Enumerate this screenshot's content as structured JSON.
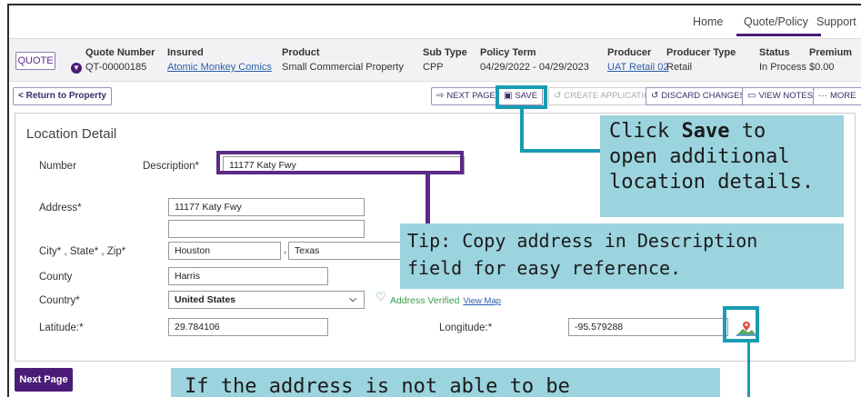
{
  "topnav": {
    "items": [
      "Home",
      "Quote/Policy",
      "Support"
    ],
    "active": "Quote/Policy"
  },
  "header": {
    "badge": "QUOTE",
    "quote_number_label": "Quote Number",
    "quote_number": "QT-00000185",
    "insured_label": "Insured",
    "insured": "Atomic Monkey Comics",
    "product_label": "Product",
    "product": "Small Commercial Property",
    "subtype_label": "Sub Type",
    "subtype": "CPP",
    "term_label": "Policy Term",
    "term": "04/29/2022 - 04/29/2023",
    "producer_label": "Producer",
    "producer": "UAT Retail 02",
    "producer_type_label": "Producer Type",
    "producer_type": "Retail",
    "status_label": "Status",
    "status": "In Process",
    "premium_label": "Premium",
    "premium": "$0.00"
  },
  "toolbar": {
    "return_label": "< Return to Property",
    "next_page": "NEXT PAGE",
    "save": "SAVE",
    "create_application": "CREATE APPLICATION",
    "discard_changes": "DISCARD CHANGES",
    "view_notes": "VIEW NOTES",
    "more": "MORE"
  },
  "form": {
    "title": "Location Detail",
    "number_label": "Number",
    "description_label": "Description*",
    "description_value": "11177 Katy Fwy",
    "address_label": "Address*",
    "address1": "11177 Katy Fwy",
    "address2": "",
    "city_state_zip_label": "City* , State* , Zip*",
    "city": "Houston",
    "state": "Texas",
    "county_label": "County",
    "county": "Harris",
    "country_label": "Country*",
    "country": "United States",
    "verified_text": "Address Verified",
    "view_map": "View Map",
    "latitude_label": "Latitude:*",
    "latitude": "29.784106",
    "longitude_label": "Longitude:*",
    "longitude": "-95.579288"
  },
  "next_button": "Next Page",
  "callouts": {
    "save_pre": "Click ",
    "save_bold": "Save",
    "save_post": " to",
    "save_line2": "open additional",
    "save_line3": "location details.",
    "tip_line1": "Tip: Copy address in Description",
    "tip_line2": "field for easy reference.",
    "bottom_line1": "If the address is not able to be"
  },
  "colors": {
    "brand_purple": "#4a1c78",
    "callout_bg": "#9bd3de",
    "callout_border_teal": "#1a9bb4",
    "verified_green": "#3a9d4a"
  }
}
